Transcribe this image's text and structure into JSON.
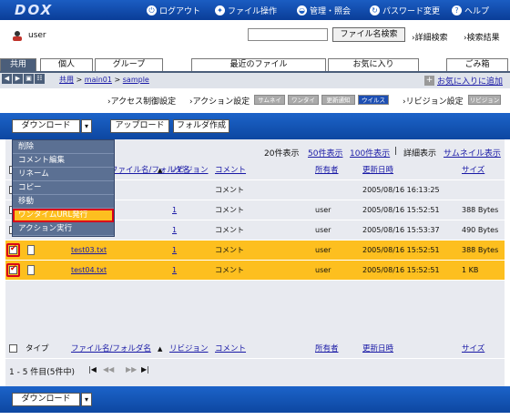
{
  "header": {
    "logo": "DOX",
    "nav": [
      {
        "icon": "logout-icon",
        "label": "ログアウト"
      },
      {
        "icon": "file-ops-icon",
        "label": "ファイル操作"
      },
      {
        "icon": "admin-icon",
        "label": "管理・照会"
      },
      {
        "icon": "password-icon",
        "label": "パスワード変更"
      },
      {
        "icon": "help-icon",
        "label": "ヘルプ"
      }
    ]
  },
  "userbar": {
    "username": "user",
    "search_value": "",
    "search_button": "ファイル名検索",
    "detail_search": "詳細検索",
    "search_results": "検索結果"
  },
  "tabs": {
    "shared": "共用",
    "personal": "個人",
    "group": "グループ",
    "recent": "最近のファイル",
    "favorites": "お気に入り",
    "trash": "ごみ箱"
  },
  "breadcrumb": [
    "共用",
    "main01",
    "sample"
  ],
  "favorite_add": "お気に入りに追加",
  "settings": {
    "access_control": "アクセス制御設定",
    "action": "アクション設定",
    "badges": [
      "サムネイル",
      "ワンタイム",
      "更新通知",
      "ウイルス",
      "リビジョン"
    ],
    "revision": "リビジョン設定"
  },
  "toolbar": {
    "download": "ダウンロード",
    "upload": "アップロード",
    "create_folder": "フォルダ作成"
  },
  "dropdown_menu": [
    "削除",
    "コメント編集",
    "リネーム",
    "コピー",
    "移動",
    "ワンタイムURL発行",
    "アクション実行"
  ],
  "view_options": {
    "show20": "20件表示",
    "show50": "50件表示",
    "show100": "100件表示",
    "detail": "詳細表示",
    "thumbnail": "サムネイル表示"
  },
  "table": {
    "columns": {
      "type": "タイプ",
      "name": "ファイル名/フォルダ名",
      "revision": "リビジョン",
      "comment": "コメント",
      "owner": "所有者",
      "updated": "更新日時",
      "size": "サイズ"
    },
    "rows": [
      {
        "name": "",
        "revision": "",
        "comment": "コメント",
        "owner": "",
        "updated": "2005/08/16 16:13:25",
        "size": "",
        "selected": false
      },
      {
        "name": "",
        "revision": "1",
        "comment": "コメント",
        "owner": "user",
        "updated": "2005/08/16 15:52:51",
        "size": "388 Bytes",
        "selected": false
      },
      {
        "name": "",
        "revision": "1",
        "comment": "コメント",
        "owner": "user",
        "updated": "2005/08/16 15:53:37",
        "size": "490 Bytes",
        "selected": false
      },
      {
        "name": "test03.txt",
        "revision": "1",
        "comment": "コメント",
        "owner": "user",
        "updated": "2005/08/16 15:52:51",
        "size": "388 Bytes",
        "selected": true
      },
      {
        "name": "test04.txt",
        "revision": "1",
        "comment": "コメント",
        "owner": "user",
        "updated": "2005/08/16 15:52:51",
        "size": "1 KB",
        "selected": true
      }
    ]
  },
  "pager": {
    "summary": "1 - 5 件目(5件中)",
    "first": "|◀",
    "prev": "◀◀",
    "next": "▶▶",
    "last": "▶|"
  },
  "footer_toolbar": {
    "download": "ダウンロード"
  }
}
